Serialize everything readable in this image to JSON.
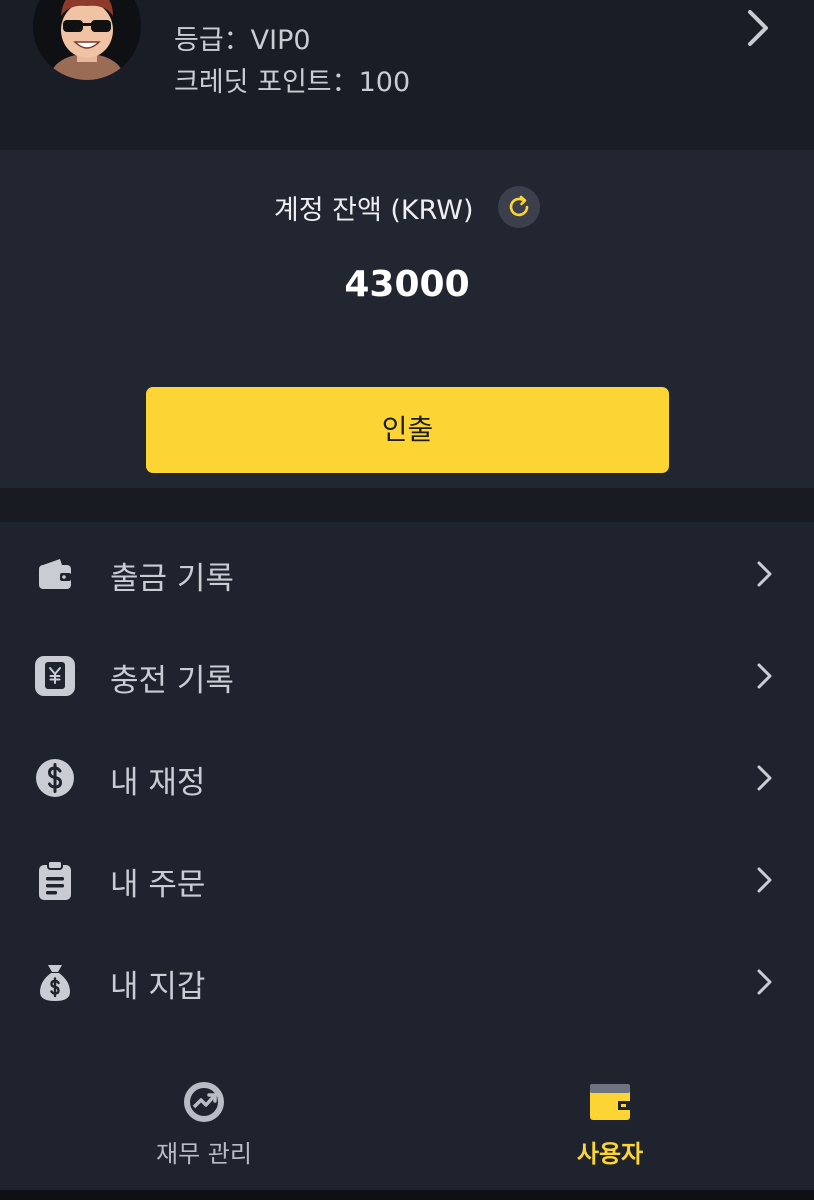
{
  "profile": {
    "level_text": "등급：VIP0",
    "credit_text": "크레딧 포인트：100",
    "avatar_icon": "avatar-sunglasses",
    "chevron_icon": "chevron-right-icon"
  },
  "balance": {
    "title": "계정 잔액 (KRW)",
    "amount": "43000",
    "refresh_icon": "refresh-icon",
    "withdraw_label": "인출"
  },
  "menu": {
    "items": [
      {
        "label": "출금 기록",
        "icon": "wallet-icon"
      },
      {
        "label": "충전 기록",
        "icon": "yen-receipt-icon"
      },
      {
        "label": "내 재정",
        "icon": "dollar-coin-icon"
      },
      {
        "label": "내 주문",
        "icon": "clipboard-icon"
      },
      {
        "label": "내 지갑",
        "icon": "money-bag-icon"
      }
    ]
  },
  "tabbar": {
    "tabs": [
      {
        "label": "재무 관리",
        "icon": "finance-chart-icon",
        "active": false
      },
      {
        "label": "사용자",
        "icon": "user-wallet-icon",
        "active": true
      }
    ]
  },
  "colors": {
    "accent": "#fcd535",
    "background": "#1f232d",
    "header": "#191d25",
    "card": "#212631",
    "text_muted": "#c9ccd2"
  }
}
